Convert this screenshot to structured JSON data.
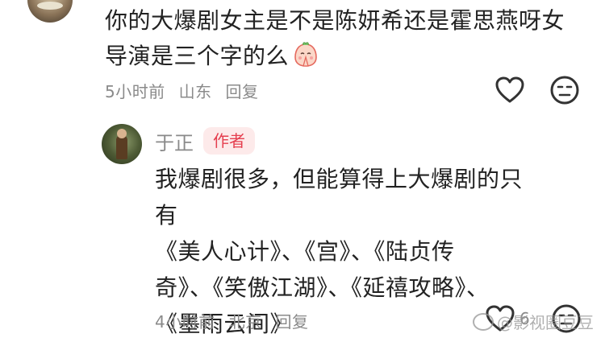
{
  "top_comment": {
    "text_line1": "你的大爆剧女主是不是陈妍希还是霍思燕呀女",
    "text_line2": "导演是三个字的么",
    "emoji": "praying-face-emoji",
    "time": "5小时前",
    "location": "山东",
    "reply_label": "回复",
    "like_icon": "heart-outline-icon",
    "dislike_icon": "neutral-face-icon"
  },
  "reply": {
    "author": "于正",
    "badge": "作者",
    "text_lines": [
      "我爆剧很多，但能算得上大爆剧的只有",
      "《美人心计》、《宫》、《陆贞传",
      "奇》、《笑傲江湖》、《延禧攻略》、",
      "《墨雨云间》"
    ],
    "time": "4小时前",
    "location": "北京",
    "reply_label": "回复",
    "like_count": "6"
  },
  "watermark": {
    "text": "@影视圈豆豆"
  },
  "colors": {
    "badge_bg": "#fdeaea",
    "badge_text": "#e53e4e",
    "meta_text": "#8a8a8a"
  }
}
